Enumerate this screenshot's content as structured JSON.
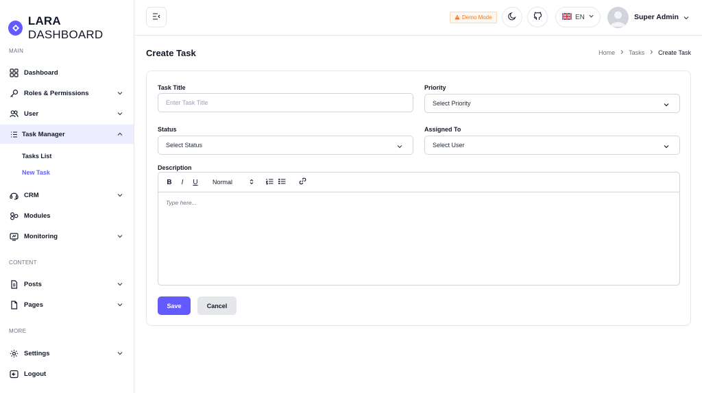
{
  "brand": {
    "name_bold": "LARA",
    "name_rest": " DASHBOARD"
  },
  "sidebar": {
    "sections": {
      "main": "MAIN",
      "content": "CONTENT",
      "more": "MORE"
    },
    "items": {
      "dashboard": "Dashboard",
      "roles": "Roles & Permissions",
      "user": "User",
      "task_manager": "Task Manager",
      "tasks_list": "Tasks List",
      "new_task": "New Task",
      "crm": "CRM",
      "modules": "Modules",
      "monitoring": "Monitoring",
      "posts": "Posts",
      "pages": "Pages",
      "settings": "Settings",
      "logout": "Logout"
    }
  },
  "header": {
    "demo_mode": "Demo Mode",
    "language": "EN",
    "user_name": "Super Admin"
  },
  "page": {
    "title": "Create Task",
    "breadcrumb": [
      "Home",
      "Tasks",
      "Create Task"
    ]
  },
  "form": {
    "task_title_label": "Task Title",
    "task_title_placeholder": "Enter Task Title",
    "priority_label": "Priority",
    "priority_value": "Select Priority",
    "status_label": "Status",
    "status_value": "Select Status",
    "assigned_label": "Assigned To",
    "assigned_value": "Select User",
    "description_label": "Description",
    "editor": {
      "bold": "B",
      "italic": "I",
      "underline": "U",
      "size": "Normal",
      "placeholder": "Type here..."
    },
    "save": "Save",
    "cancel": "Cancel"
  },
  "colors": {
    "accent": "#635bff",
    "active_bg": "#eceefe",
    "warning": "#f97316"
  }
}
